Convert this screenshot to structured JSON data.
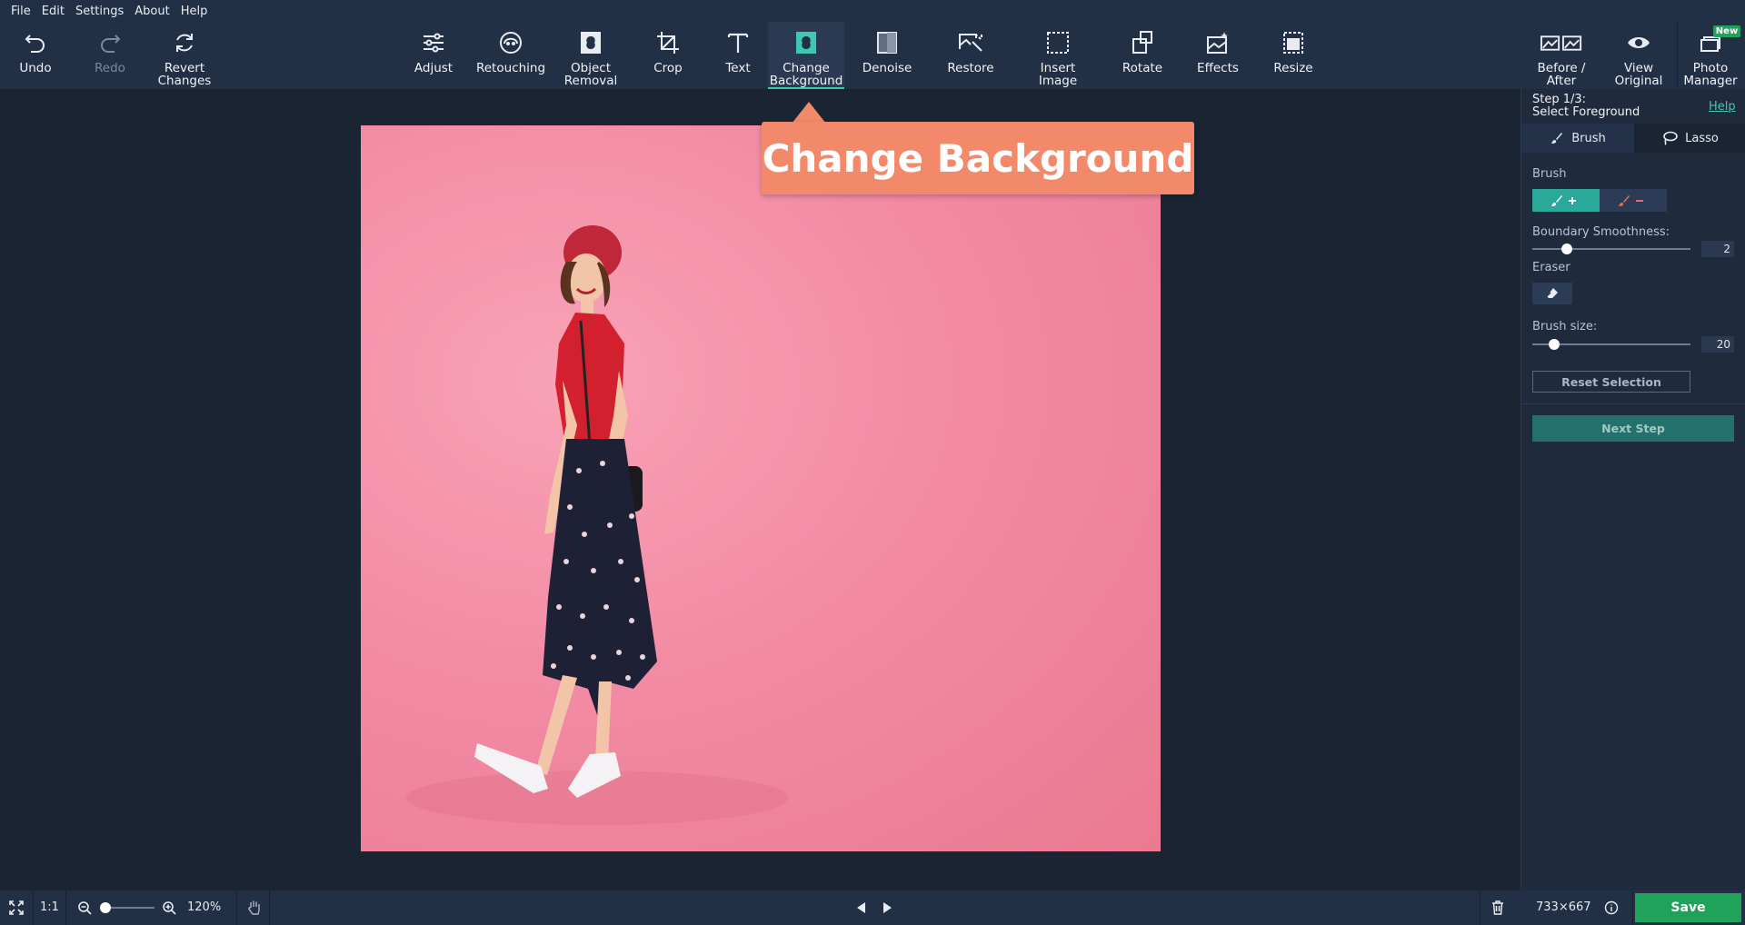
{
  "menu": [
    "File",
    "Edit",
    "Settings",
    "About",
    "Help"
  ],
  "toolbar": {
    "undo": "Undo",
    "redo": "Redo",
    "revert_l1": "Revert",
    "revert_l2": "Changes",
    "tools": {
      "adjust": "Adjust",
      "retouching": "Retouching",
      "object_l1": "Object",
      "object_l2": "Removal",
      "crop": "Crop",
      "text": "Text",
      "change_l1": "Change",
      "change_l2": "Background",
      "denoise": "Denoise",
      "restore": "Restore",
      "insert_l1": "Insert",
      "insert_l2": "Image",
      "rotate": "Rotate",
      "effects": "Effects",
      "resize": "Resize"
    },
    "right": {
      "before_l1": "Before /",
      "before_l2": "After",
      "view_l1": "View",
      "view_l2": "Original",
      "photo_l1": "Photo",
      "photo_l2": "Manager",
      "new_badge": "New"
    },
    "accent": "#3fc7b3"
  },
  "callout": "Change Background",
  "panel": {
    "step_l1": "Step 1/3:",
    "step_l2": "Select Foreground",
    "help": "Help",
    "tab_brush": "Brush",
    "tab_lasso": "Lasso",
    "brush_label": "Brush",
    "boundary_label": "Boundary Smoothness:",
    "boundary_value": "2",
    "boundary_level": 0.22,
    "eraser_label": "Eraser",
    "brush_size_label": "Brush size:",
    "brush_size_value": "20",
    "brush_size_level": 0.14,
    "reset": "Reset Selection",
    "next": "Next Step"
  },
  "bottom": {
    "one_to_one": "1:1",
    "zoom": "120%",
    "zoom_level": 0.1,
    "dimensions": "733×667",
    "save": "Save",
    "save_color": "#1fa35a"
  }
}
